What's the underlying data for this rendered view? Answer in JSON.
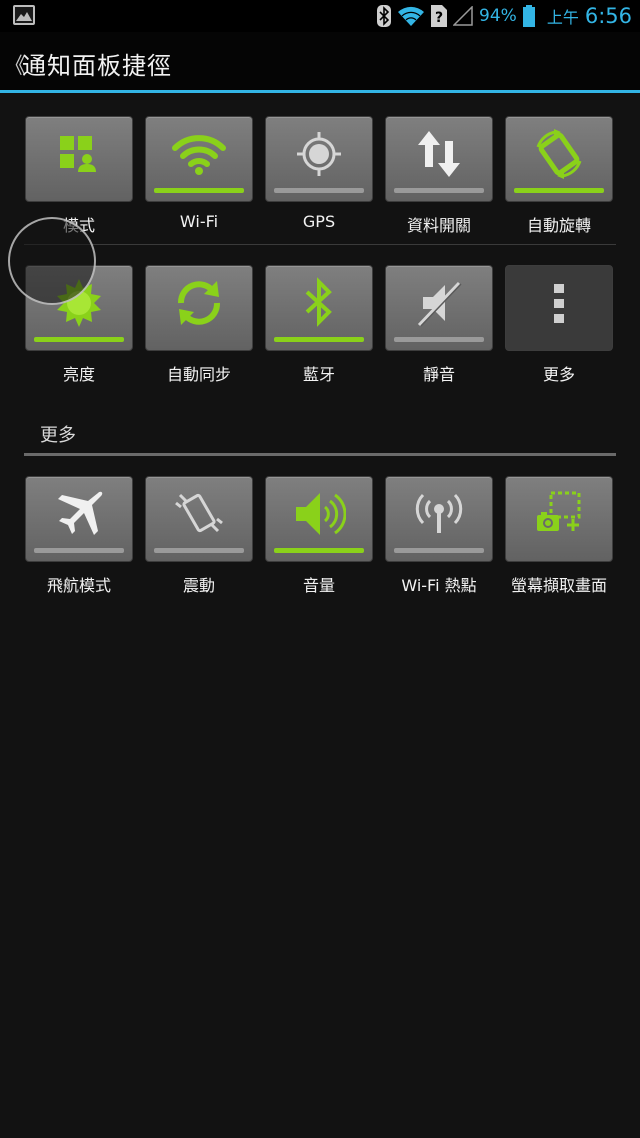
{
  "status_bar": {
    "battery_percent": "94%",
    "ampm": "上午",
    "time": "6:56",
    "icons": [
      "gallery-icon",
      "bluetooth-icon",
      "wifi-icon",
      "sim-unknown-icon",
      "signal-icon",
      "battery-icon"
    ]
  },
  "action_bar": {
    "back_glyph": "《",
    "title": "通知面板捷徑"
  },
  "colors": {
    "accent_blue": "#33b5e5",
    "toggle_on_green": "#8ad11a",
    "toggle_off_gray": "#9a9a9a",
    "tile_gray": "#6f6f6f"
  },
  "tiles": {
    "mode": {
      "label": "模式",
      "icon": "mode-icon",
      "state": "none"
    },
    "wifi": {
      "label": "Wi-Fi",
      "icon": "wifi-icon",
      "state": "on"
    },
    "gps": {
      "label": "GPS",
      "icon": "gps-icon",
      "state": "off"
    },
    "data": {
      "label": "資料開關",
      "icon": "data-transfer-icon",
      "state": "off"
    },
    "rotate": {
      "label": "自動旋轉",
      "icon": "auto-rotate-icon",
      "state": "on"
    },
    "brightness": {
      "label": "亮度",
      "icon": "brightness-icon",
      "state": "on"
    },
    "sync": {
      "label": "自動同步",
      "icon": "sync-icon",
      "state": "none"
    },
    "bluetooth": {
      "label": "藍牙",
      "icon": "bluetooth-icon",
      "state": "on"
    },
    "mute": {
      "label": "靜音",
      "icon": "mute-icon",
      "state": "off"
    },
    "more": {
      "label": "更多",
      "icon": "more-icon",
      "state": "none"
    },
    "airplane": {
      "label": "飛航模式",
      "icon": "airplane-icon",
      "state": "off"
    },
    "vibrate": {
      "label": "震動",
      "icon": "vibrate-icon",
      "state": "off"
    },
    "volume": {
      "label": "音量",
      "icon": "volume-icon",
      "state": "on"
    },
    "hotspot": {
      "label": "Wi-Fi 熱點",
      "icon": "hotspot-icon",
      "state": "off"
    },
    "screenshot": {
      "label": "螢幕擷取畫面",
      "icon": "screenshot-icon",
      "state": "none"
    }
  },
  "more_section": {
    "header": "更多"
  }
}
